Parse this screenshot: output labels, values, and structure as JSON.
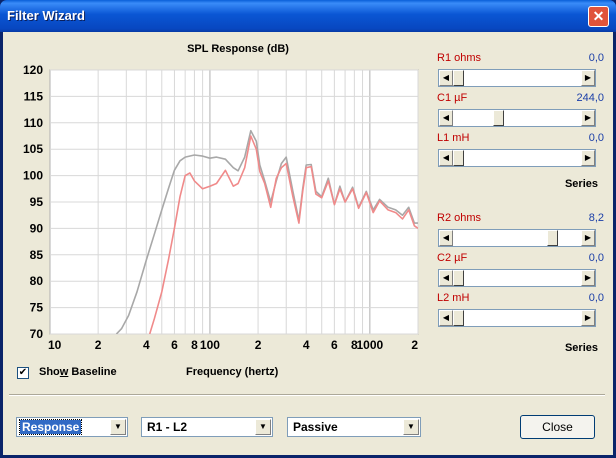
{
  "window": {
    "title": "Filter Wizard",
    "close_glyph": "✕"
  },
  "chart_data": {
    "type": "line",
    "title": "SPL Response (dB)",
    "xlabel": "Frequency (hertz)",
    "ylabel": "",
    "x_scale": "log",
    "xlim": [
      10,
      2000
    ],
    "ylim": [
      70,
      120
    ],
    "grid": true,
    "y_ticks": [
      "120",
      "115",
      "110",
      "105",
      "100",
      "95",
      "90",
      "85",
      "80",
      "75",
      "70"
    ],
    "x_ticks": [
      "10",
      "2",
      "4",
      "6",
      "8",
      "100",
      "2",
      "4",
      "6",
      "8",
      "1000",
      "2"
    ],
    "series": [
      {
        "color": "#a8a8a8",
        "x": [
          26,
          28,
          31,
          35,
          40,
          45,
          50,
          55,
          60,
          65,
          70,
          80,
          90,
          100,
          110,
          125,
          140,
          150,
          165,
          180,
          195,
          205,
          220,
          240,
          260,
          280,
          300,
          330,
          360,
          380,
          400,
          430,
          460,
          500,
          550,
          600,
          650,
          700,
          780,
          850,
          950,
          1050,
          1150,
          1300,
          1450,
          1600,
          1750,
          1900,
          2000
        ],
        "y": [
          70,
          71,
          73.5,
          78,
          84,
          89,
          93.5,
          97.5,
          101,
          102.8,
          103.5,
          103.9,
          103.7,
          103.3,
          103.5,
          103.1,
          101.5,
          100.9,
          103.5,
          108.5,
          106.5,
          102,
          99,
          95,
          99,
          102.3,
          103.5,
          97,
          91.5,
          97.5,
          102,
          102.1,
          97,
          96,
          99.5,
          94.5,
          98,
          95,
          97.8,
          94,
          97,
          93.5,
          95.5,
          94,
          93.5,
          92.5,
          94,
          91,
          91
        ]
      },
      {
        "color": "#f08a8a",
        "x": [
          42,
          45,
          50,
          55,
          60,
          65,
          70,
          75,
          80,
          90,
          100,
          110,
          125,
          140,
          150,
          165,
          180,
          195,
          205,
          220,
          240,
          260,
          280,
          300,
          330,
          360,
          380,
          400,
          430,
          460,
          500,
          550,
          600,
          650,
          700,
          780,
          850,
          950,
          1050,
          1150,
          1300,
          1450,
          1600,
          1750,
          1900,
          2000
        ],
        "y": [
          70,
          73,
          78,
          84,
          90,
          96,
          100,
          100.5,
          99,
          97.5,
          98,
          98.5,
          101,
          98,
          98.5,
          101.5,
          107.5,
          105,
          100.8,
          98.5,
          94,
          99.5,
          101.5,
          102.3,
          96,
          91,
          97,
          101.5,
          101.7,
          96.5,
          95.8,
          99,
          94.5,
          97.5,
          95,
          97.5,
          93.8,
          96.8,
          93,
          95.2,
          93.5,
          93,
          91.8,
          93.5,
          90.5,
          90
        ]
      }
    ]
  },
  "baseline": {
    "label_pre": "Sho",
    "label_accel": "w",
    "label_post": " Baseline",
    "checked": true,
    "check_glyph": "✔"
  },
  "series_label": "Series",
  "controls": [
    {
      "label": "R1  ohms",
      "value": "0,0",
      "thumb": 0.0
    },
    {
      "label": "C1  µF",
      "value": "244,0",
      "thumb": 0.34
    },
    {
      "label": "L1  mH",
      "value": "0,0",
      "thumb": 0.0
    },
    {
      "label": "R2  ohms",
      "value": "8,2",
      "thumb": 0.8
    },
    {
      "label": "C2  µF",
      "value": "0,0",
      "thumb": 0.0
    },
    {
      "label": "L2  mH",
      "value": "0,0",
      "thumb": 0.0
    }
  ],
  "bottom": {
    "view_select": "Response",
    "branch_select": "R1 - L2",
    "type_select": "Passive",
    "close_label": "Close",
    "dropdown_glyph": "▼"
  },
  "arrow_left": "◀",
  "arrow_right": "▶"
}
